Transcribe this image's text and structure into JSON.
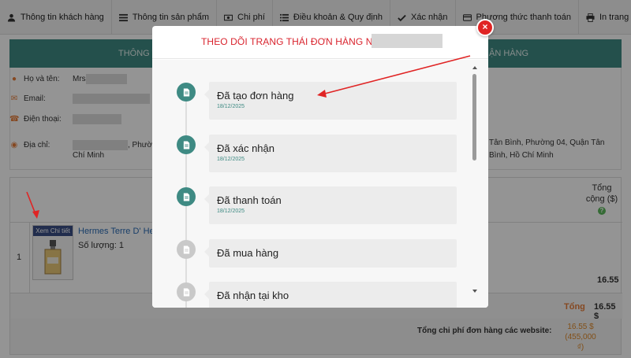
{
  "toolbar": {
    "items": [
      {
        "label": "Thông tin khách hàng",
        "icon": "user-icon"
      },
      {
        "label": "Thông tin sản phẩm",
        "icon": "list-icon"
      },
      {
        "label": "Chi phí",
        "icon": "money-icon"
      },
      {
        "label": "Điều khoản & Quy định",
        "icon": "list-ordered-icon"
      },
      {
        "label": "Xác nhận",
        "icon": "check-icon"
      },
      {
        "label": "Phương thức thanh toán",
        "icon": "credit-card-icon"
      },
      {
        "label": "In trang",
        "icon": "print-icon"
      }
    ]
  },
  "background": {
    "header_left": "THÔNG T",
    "header_right": "ẬN HÀNG",
    "customer": {
      "name_label": "Họ và tên:",
      "name_value": "Mrs",
      "email_label": "Email:",
      "phone_label": "Điện thoại:",
      "address_label": "Địa chỉ:",
      "address_part": ", Phườ",
      "address_line2": "Chí Minh",
      "address_right": "Tân Bình, Phường 04, Quận Tân Bình, Hồ Chí Minh"
    },
    "product": {
      "total_header": "Tổng cộng ($)",
      "help_glyph": "?",
      "row_number": "1",
      "view_detail": "Xem Chi tiết",
      "name": "Hermes Terre D' He",
      "quantity": "Số lượng: 1",
      "price": "16.55",
      "total_label": "Tổng",
      "total_value": "16.55 $"
    },
    "summary": {
      "label": "Tổng chi phí đơn hàng các website:",
      "value_usd": "16.55 $",
      "value_vnd": "(455,000 ₫)"
    }
  },
  "modal": {
    "title": "THEO DÕI TRẠNG THÁI ĐƠN HÀNG NO.",
    "close_glyph": "×",
    "steps": [
      {
        "title": "Đã tạo đơn hàng",
        "date": "18/12/2025",
        "done": true
      },
      {
        "title": "Đã xác nhận",
        "date": "18/12/2025",
        "done": true
      },
      {
        "title": "Đã thanh toán",
        "date": "18/12/2025",
        "done": true
      },
      {
        "title": "Đã mua hàng",
        "date": "",
        "done": false
      },
      {
        "title": "Đã nhận tại kho",
        "date": "",
        "done": false
      }
    ]
  },
  "colors": {
    "accent_teal": "#3e8a83",
    "title_red": "#d9232d",
    "close_red": "#e02424",
    "orange": "#e57d3a",
    "link_blue": "#2a6bb5"
  }
}
